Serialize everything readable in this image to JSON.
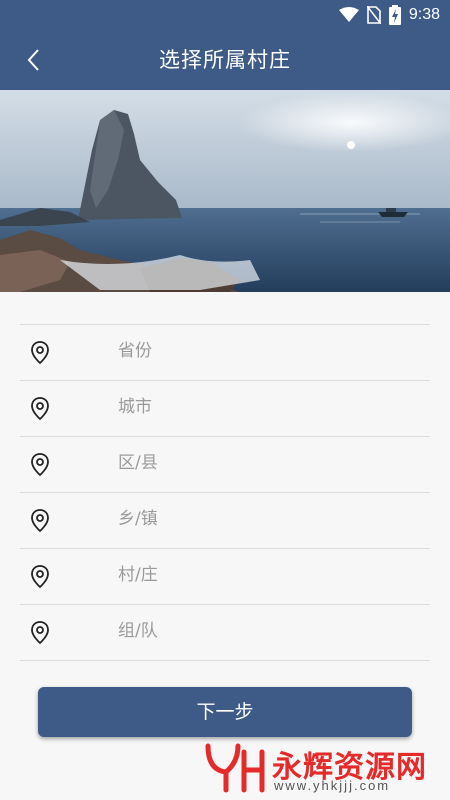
{
  "status_bar": {
    "time": "9:38",
    "icons": [
      "wifi-icon",
      "no-sim-icon",
      "battery-charging-icon"
    ]
  },
  "header": {
    "title": "选择所属村庄",
    "back_icon": "chevron-left-icon"
  },
  "form": {
    "rows": [
      {
        "label": "省份",
        "icon": "location-pin-icon"
      },
      {
        "label": "城市",
        "icon": "location-pin-icon"
      },
      {
        "label": "区/县",
        "icon": "location-pin-icon"
      },
      {
        "label": "乡/镇",
        "icon": "location-pin-icon"
      },
      {
        "label": "村/庄",
        "icon": "location-pin-icon"
      },
      {
        "label": "组/队",
        "icon": "location-pin-icon"
      }
    ]
  },
  "actions": {
    "next_label": "下一步"
  },
  "watermark": {
    "text": "永辉资源网",
    "url": "www.yhkjjj.com"
  },
  "colors": {
    "primary": "#3e5a86",
    "background": "#f7f7f7",
    "divider": "#dcdcdc",
    "placeholder": "#9a9a9a",
    "watermark": "#e52a2a"
  }
}
